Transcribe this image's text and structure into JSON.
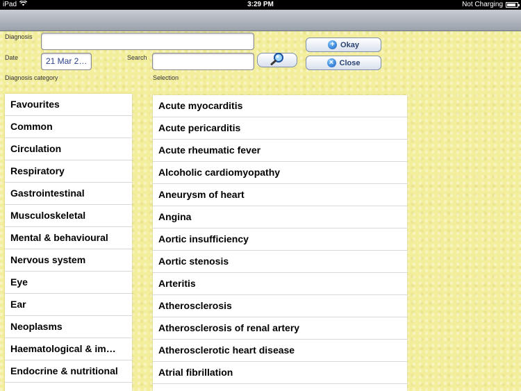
{
  "status": {
    "device": "iPad",
    "time": "3:29 PM",
    "charging": "Not Charging",
    "battery_level": 0.85
  },
  "form": {
    "diagnosis_label": "Diagnosis",
    "diagnosis_value": "",
    "date_label": "Date",
    "date_value": "21 Mar 2…",
    "search_label": "Search",
    "search_value": "",
    "category_label": "Diagnosis category",
    "selection_label": "Selection"
  },
  "buttons": {
    "okay": "Okay",
    "close": "Close"
  },
  "icons": {
    "search": "magnifier-icon",
    "okay": "plus-icon",
    "close": "x-icon"
  },
  "categories": [
    "Favourites",
    "Common",
    "Circulation",
    "Respiratory",
    "Gastrointestinal",
    "Musculoskeletal",
    "Mental & behavioural",
    "Nervous system",
    "Eye",
    "Ear",
    "Neoplasms",
    "Haematological & im…",
    "Endocrine & nutritional"
  ],
  "selections": [
    "Acute myocarditis",
    "Acute pericarditis",
    "Acute rheumatic fever",
    "Alcoholic cardiomyopathy",
    "Aneurysm of heart",
    "Angina",
    "Aortic insufficiency",
    "Aortic stenosis",
    "Arteritis",
    "Atherosclerosis",
    "Atherosclerosis of renal artery",
    "Atherosclerotic heart disease",
    "Atrial fibrillation"
  ]
}
